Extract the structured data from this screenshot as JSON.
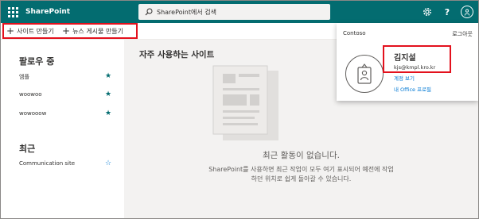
{
  "colors": {
    "topbar": "#036c70",
    "highlight": "#e3111d",
    "link": "#0078d4",
    "main_bg": "#f3f2f1"
  },
  "header": {
    "app_name": "SharePoint",
    "search_placeholder": "SharePoint에서 검색",
    "settings_icon": "gear-icon",
    "help_label": "?",
    "avatar_icon": "person-icon"
  },
  "commands": {
    "create_site": "사이트 만들기",
    "create_news": "뉴스 게시물 만들기"
  },
  "sidebar": {
    "following_heading": "팔로우 중",
    "following": [
      {
        "label": "엠플"
      },
      {
        "label": "woowoo"
      },
      {
        "label": "wowooow"
      }
    ],
    "recent_heading": "최근",
    "recent": [
      {
        "label": "Communication site"
      }
    ]
  },
  "main": {
    "title": "자주 사용하는 사이트",
    "empty_title": "최근 활동이 없습니다.",
    "empty_line1": "SharePoint를 사용하면 최근 작업이 모두 여기 표시되어 예전에 작업",
    "empty_line2": "하던 위치로 쉽게 돌아갈 수 있습니다."
  },
  "profile": {
    "org": "Contoso",
    "sign_out": "로그아웃",
    "name": "김지설",
    "email": "kjs@kmpl.kro.kr",
    "account_link": "계정 보기",
    "office_profile_link": "내 Office 프로필"
  }
}
